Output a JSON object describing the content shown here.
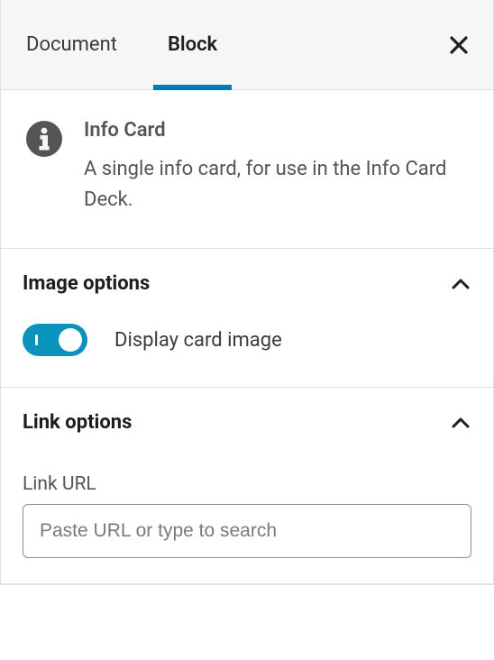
{
  "tabs": {
    "document": "Document",
    "block": "Block"
  },
  "header": {
    "title": "Info Card",
    "description": "A single info card, for use in the Info Card Deck."
  },
  "sections": {
    "image": {
      "title": "Image options",
      "toggle_label": "Display card image",
      "toggle_on": true
    },
    "link": {
      "title": "Link options",
      "url_label": "Link URL",
      "url_value": "",
      "url_placeholder": "Paste URL or type to search"
    }
  }
}
